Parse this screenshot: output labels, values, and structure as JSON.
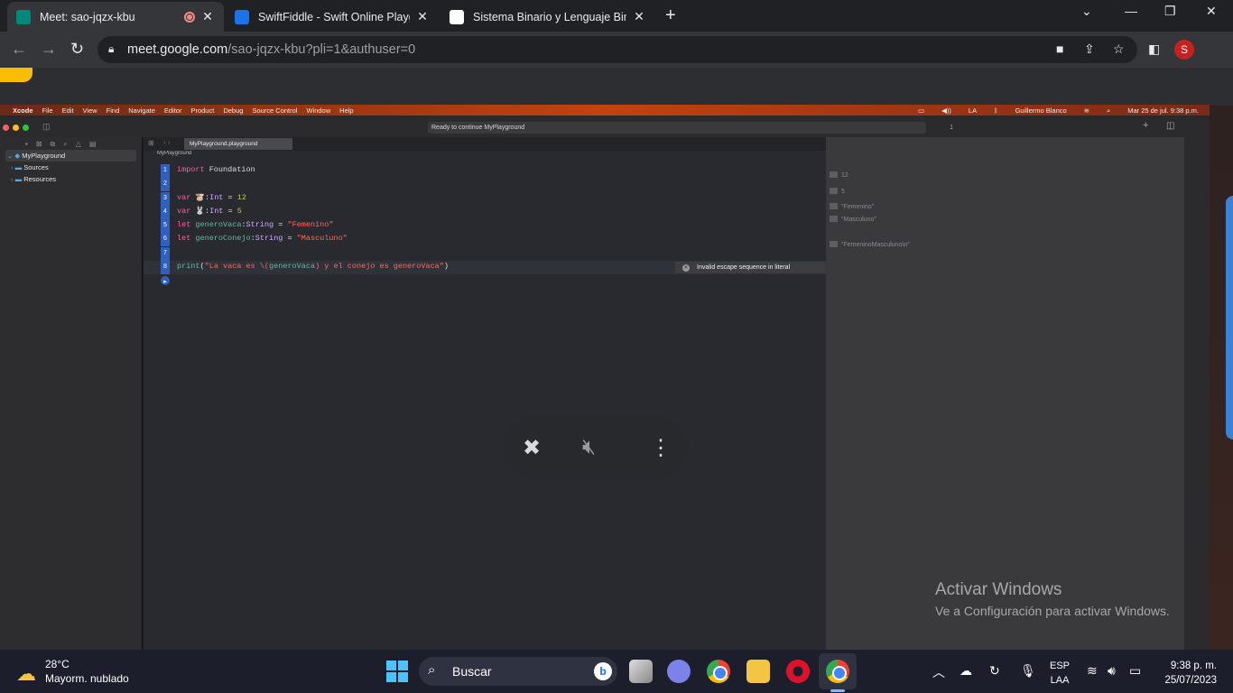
{
  "browser": {
    "tabs": [
      {
        "title": "Meet: sao-jqzx-kbu",
        "active": true
      },
      {
        "title": "SwiftFiddle - Swift Online Playgro",
        "active": false
      },
      {
        "title": "Sistema Binario y Lenguaje Binari",
        "active": false
      }
    ],
    "url_host": "meet.google.com",
    "url_path": "/sao-jqzx-kbu?pli=1&authuser=0",
    "profile_initial": "S"
  },
  "mac": {
    "menubar": [
      "Xcode",
      "File",
      "Edit",
      "View",
      "Find",
      "Navigate",
      "Editor",
      "Product",
      "Debug",
      "Source Control",
      "Window",
      "Help"
    ],
    "user": "Guillermo Blanco",
    "datetime": "Mar 25 de jul.  9:38 p.m.",
    "input_badge": "LA"
  },
  "xcode": {
    "status": "Ready to continue MyPlayground",
    "warn_count": "1",
    "file_tab": "MyPlayground.playground",
    "breadcrumb": "MyPlayground",
    "navigator": [
      {
        "label": "MyPlayground"
      },
      {
        "label": "Sources"
      },
      {
        "label": "Resources"
      }
    ],
    "code": [
      {
        "n": "1",
        "text": "import Foundation"
      },
      {
        "n": "2",
        "text": ""
      },
      {
        "n": "3",
        "text": "var 🐮:Int = 12"
      },
      {
        "n": "4",
        "text": "var 🐰:Int = 5"
      },
      {
        "n": "5",
        "text": "let generoVaca:String = \"Femenino\""
      },
      {
        "n": "6",
        "text": "let generoConejo:String = \"Masculuno\""
      },
      {
        "n": "7",
        "text": ""
      },
      {
        "n": "8",
        "text": "print(\"La vaca es \\(generoVaca) y el conejo es generoVaca\")"
      }
    ],
    "error_message": "Invalid escape sequence in literal",
    "results": [
      "12",
      "5",
      "\"Femenino\"",
      "\"Masculuno\"",
      "\"FemeninoMasculuno\\n\""
    ]
  },
  "windows_watermark": {
    "line1": "Activar Windows",
    "line2": "Ve a Configuración para activar Windows."
  },
  "taskbar": {
    "temperature": "28°C",
    "weather": "Mayorm. nublado",
    "search_label": "Buscar",
    "lang_top": "ESP",
    "lang_bottom": "LAA",
    "time": "9:38 p. m.",
    "date": "25/07/2023"
  }
}
